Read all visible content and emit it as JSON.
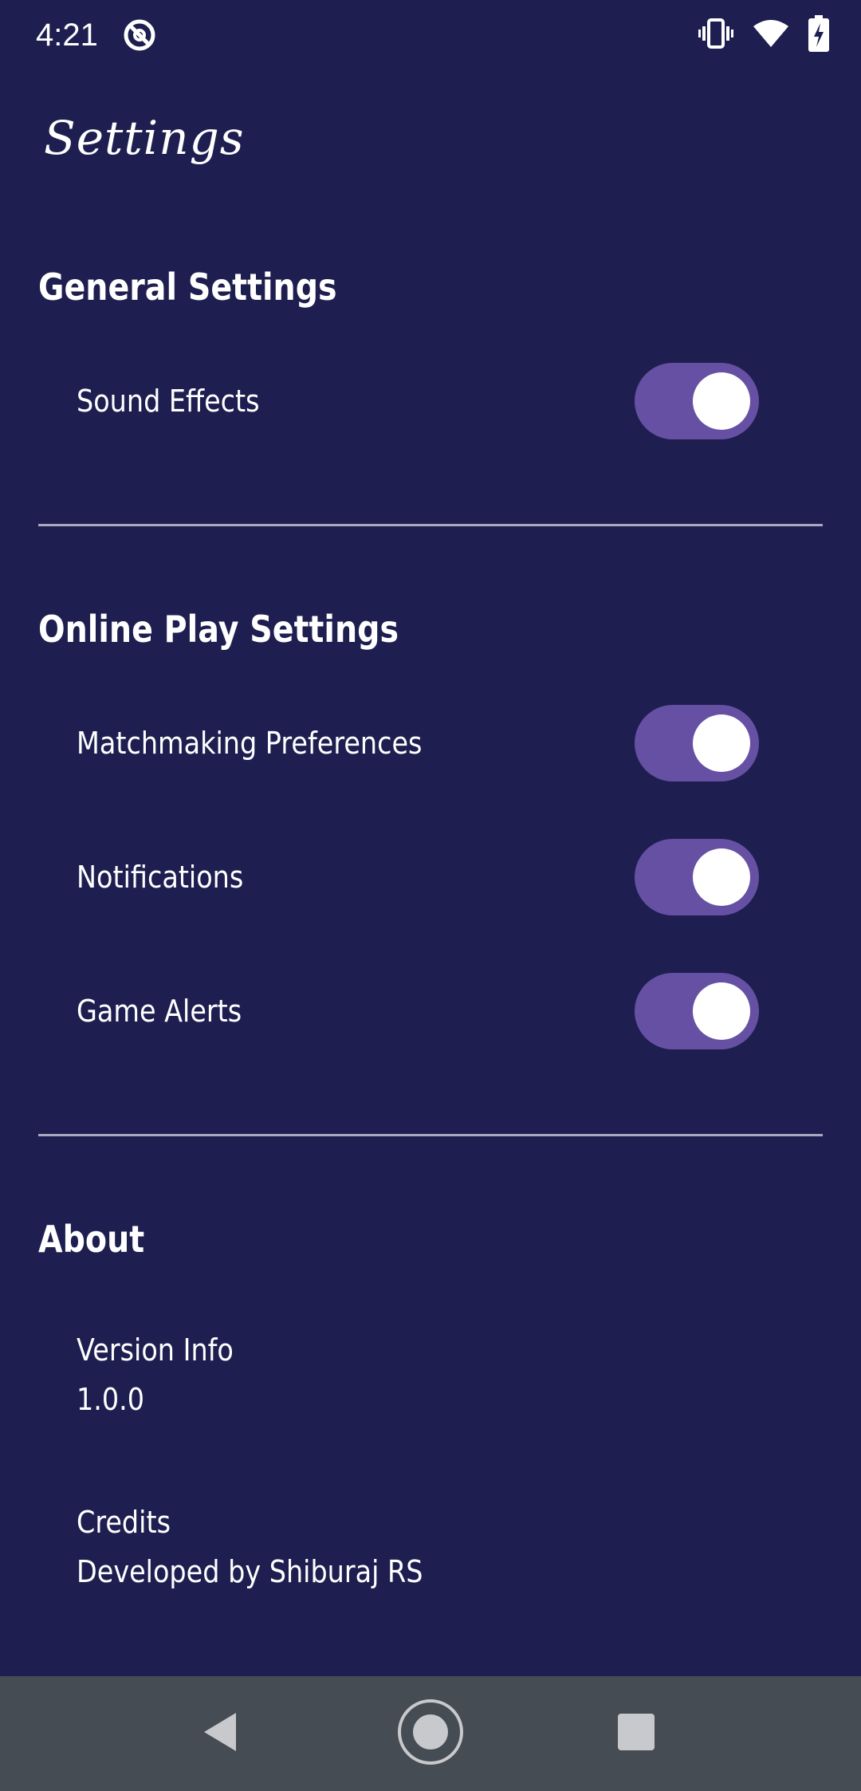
{
  "status_bar": {
    "time": "4:21",
    "app_icon": "no-entry-app-icon",
    "icons": [
      "vibrate-icon",
      "wifi-icon",
      "battery-charging-icon"
    ]
  },
  "page": {
    "title": "Settings"
  },
  "sections": {
    "general": {
      "heading": "General Settings",
      "items": [
        {
          "label": "Sound Effects",
          "enabled": true
        }
      ]
    },
    "online": {
      "heading": "Online Play Settings",
      "items": [
        {
          "label": "Matchmaking Preferences",
          "enabled": true
        },
        {
          "label": "Notifications",
          "enabled": true
        },
        {
          "label": "Game Alerts",
          "enabled": true
        }
      ]
    },
    "about": {
      "heading": "About",
      "version": {
        "title": "Version Info",
        "value": "1.0.0"
      },
      "credits": {
        "title": "Credits",
        "value": "Developed by Shiburaj RS"
      }
    }
  },
  "nav_bar": {
    "buttons": [
      "back-icon",
      "home-icon",
      "recents-icon"
    ]
  },
  "colors": {
    "background": "#1e1f50",
    "toggle_on": "#6650a4",
    "divider": "#a8a8c0",
    "nav_bar": "#464c53"
  }
}
